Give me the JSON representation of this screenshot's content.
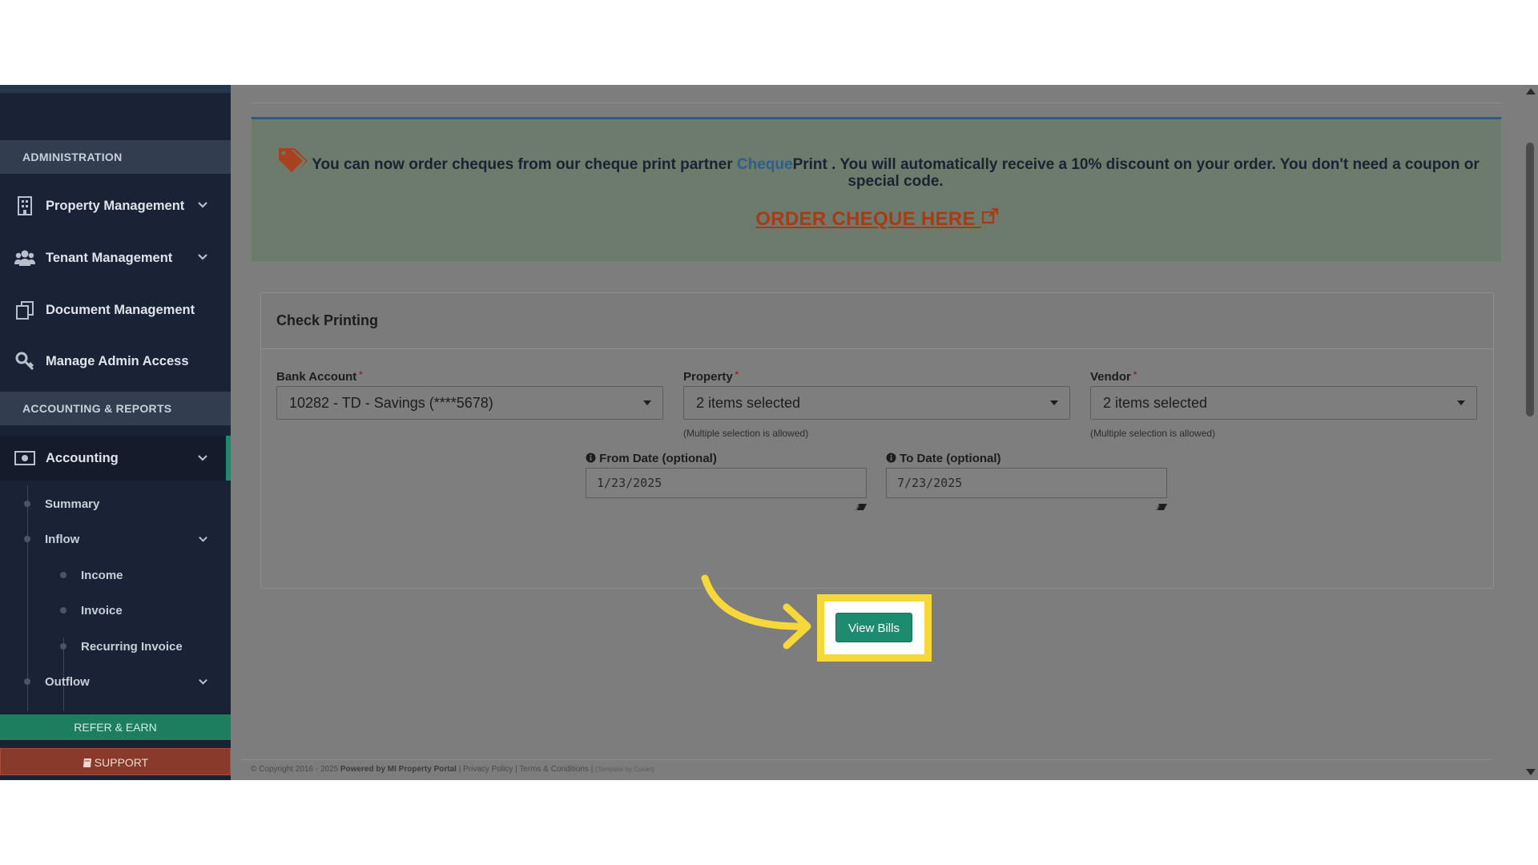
{
  "sidebar": {
    "sections": {
      "administration": "ADMINISTRATION",
      "accounting_reports": "ACCOUNTING & REPORTS"
    },
    "items": [
      {
        "label": "Property Management",
        "icon": "building-icon"
      },
      {
        "label": "Tenant Management",
        "icon": "users-icon"
      },
      {
        "label": "Document Management",
        "icon": "documents-icon"
      },
      {
        "label": "Manage Admin Access",
        "icon": "key-icon"
      },
      {
        "label": "Accounting",
        "icon": "money-icon"
      }
    ],
    "accounting_sub": {
      "summary": "Summary",
      "inflow": "Inflow",
      "income": "Income",
      "invoice": "Invoice",
      "recurring_invoice": "Recurring Invoice",
      "outflow": "Outflow"
    },
    "refer_label": "REFER & EARN",
    "support_label": "SUPPORT"
  },
  "promo": {
    "text_before": "You can now order cheques from our cheque print partner ",
    "brand_a": "Cheque",
    "brand_b": "Print",
    "text_after": " . You will automatically receive a 10% discount on your order. You don't need a coupon or special code.",
    "order_link": "ORDER CHEQUE HERE"
  },
  "check_printing": {
    "title": "Check Printing",
    "bank_account": {
      "label": "Bank Account",
      "value": "10282 - TD - Savings (****5678)"
    },
    "property": {
      "label": "Property",
      "value": "2 items selected",
      "hint": "(Multiple selection is allowed)"
    },
    "vendor": {
      "label": "Vendor",
      "value": "2 items selected",
      "hint": "(Multiple selection is allowed)"
    },
    "from_date": {
      "label": "From Date (optional)",
      "value": "1/23/2025"
    },
    "to_date": {
      "label": "To Date (optional)",
      "value": "7/23/2025"
    },
    "required_mark": "*",
    "view_bills_label": "View Bills"
  },
  "footer": {
    "copyright": "© Copyright 2016 - 2025 ",
    "powered": "Powered by MI Property Portal",
    "links": " | Privacy Policy | Terms & Conditions | ",
    "template": "(Template by Cuvan)"
  },
  "colors": {
    "sidebar_bg": "#1a2335",
    "accent_green": "#1d8c6e",
    "highlight_yellow": "#f7d83b",
    "support_red": "#8a3a2a",
    "order_link": "#a83a16"
  }
}
